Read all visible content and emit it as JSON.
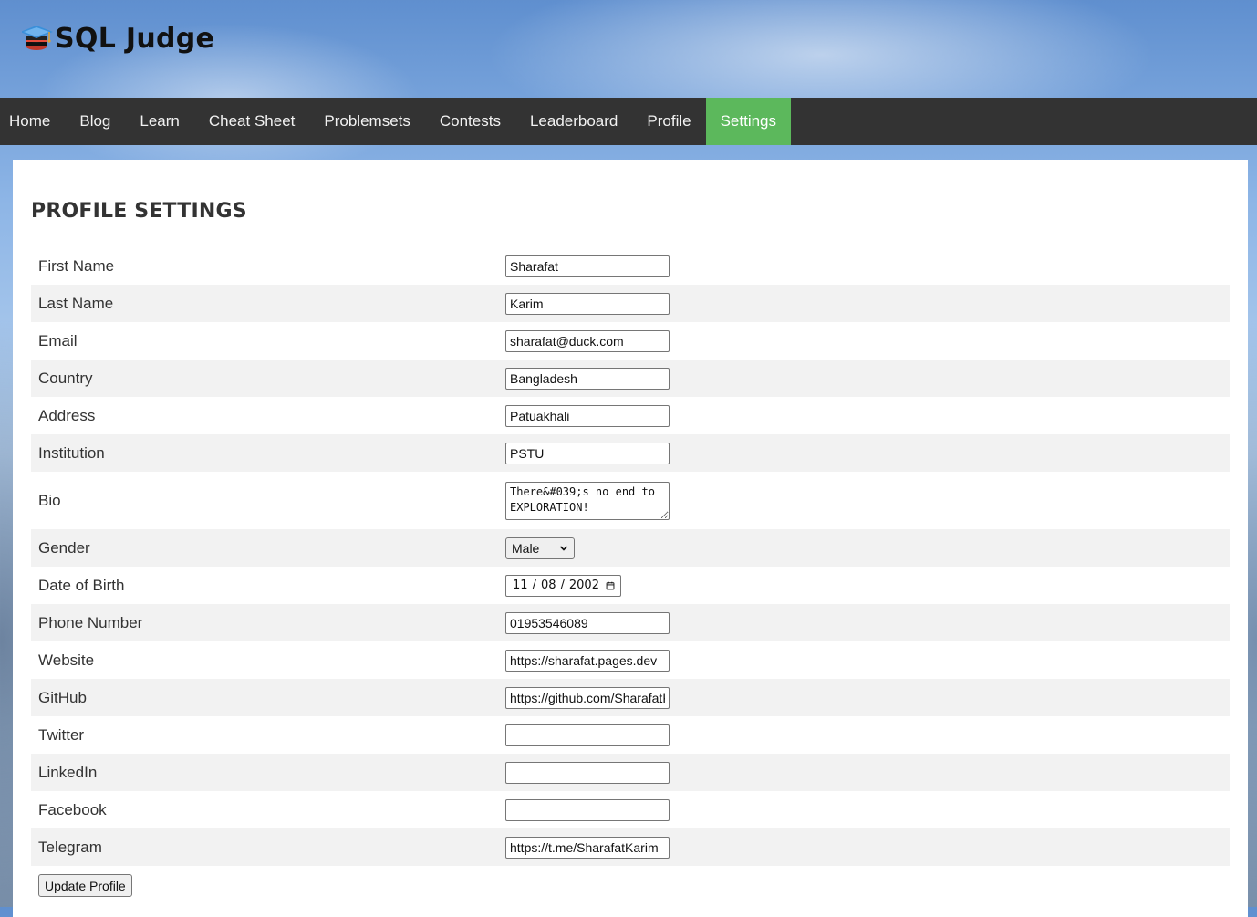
{
  "site": {
    "title": "SQL Judge",
    "logo_icon": "graduation-cap-icon"
  },
  "nav": {
    "items": [
      {
        "label": "Home",
        "active": false
      },
      {
        "label": "Blog",
        "active": false
      },
      {
        "label": "Learn",
        "active": false
      },
      {
        "label": "Cheat Sheet",
        "active": false
      },
      {
        "label": "Problemsets",
        "active": false
      },
      {
        "label": "Contests",
        "active": false
      },
      {
        "label": "Leaderboard",
        "active": false
      },
      {
        "label": "Profile",
        "active": false
      },
      {
        "label": "Settings",
        "active": true
      }
    ],
    "active_color": "#5cb85c",
    "bar_color": "#333333"
  },
  "page": {
    "title": "PROFILE SETTINGS"
  },
  "form": {
    "first_name": {
      "label": "First Name",
      "value": "Sharafat"
    },
    "last_name": {
      "label": "Last Name",
      "value": "Karim"
    },
    "email": {
      "label": "Email",
      "value": "sharafat@duck.com"
    },
    "country": {
      "label": "Country",
      "value": "Bangladesh"
    },
    "address": {
      "label": "Address",
      "value": "Patuakhali"
    },
    "institution": {
      "label": "Institution",
      "value": "PSTU"
    },
    "bio": {
      "label": "Bio",
      "value": "There&#039;s no end to EXPLORATION!"
    },
    "gender": {
      "label": "Gender",
      "value": "Male"
    },
    "dob": {
      "label": "Date of Birth",
      "day": "11",
      "month": "08",
      "year": "2002"
    },
    "phone": {
      "label": "Phone Number",
      "value": "01953546089"
    },
    "website": {
      "label": "Website",
      "value": "https://sharafat.pages.dev"
    },
    "github": {
      "label": "GitHub",
      "value": "https://github.com/SharafatKarim"
    },
    "twitter": {
      "label": "Twitter",
      "value": ""
    },
    "linkedin": {
      "label": "LinkedIn",
      "value": ""
    },
    "facebook": {
      "label": "Facebook",
      "value": ""
    },
    "telegram": {
      "label": "Telegram",
      "value": "https://t.me/SharafatKarim"
    },
    "submit_label": "Update Profile"
  }
}
